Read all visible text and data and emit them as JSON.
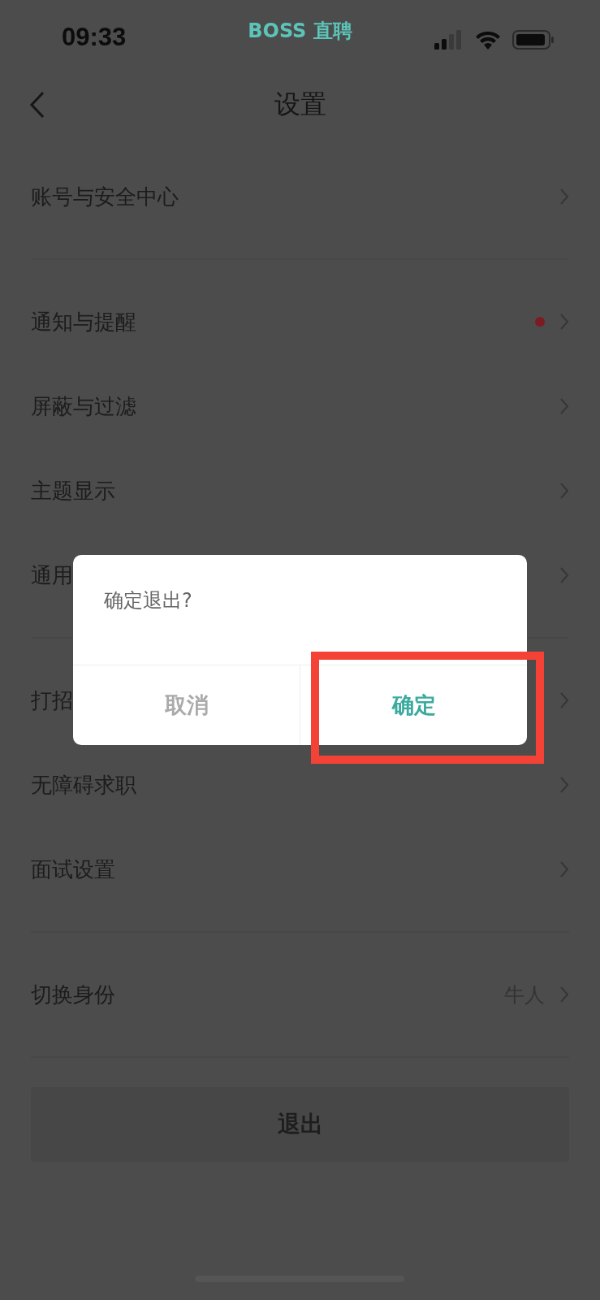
{
  "status_bar": {
    "time": "09:33",
    "app_label": "BOSS 直聘"
  },
  "nav": {
    "title": "设置"
  },
  "groups": [
    [
      {
        "label": "账号与安全中心",
        "unread": false
      }
    ],
    [
      {
        "label": "通知与提醒",
        "unread": true
      },
      {
        "label": "屏蔽与过滤",
        "unread": false
      },
      {
        "label": "主题显示",
        "unread": false
      },
      {
        "label": "通用",
        "unread": false
      }
    ],
    [
      {
        "label": "打招",
        "unread": false
      },
      {
        "label": "无障碍求职",
        "unread": false
      },
      {
        "label": "面试设置",
        "unread": false
      }
    ],
    [
      {
        "label": "切换身份",
        "unread": false,
        "value": "牛人"
      }
    ]
  ],
  "logout_button": "退出",
  "dialog": {
    "message": "确定退出?",
    "buttons": [
      {
        "label": "取消",
        "kind": "cancel",
        "highlighted": false
      },
      {
        "label": "确定",
        "kind": "confirm",
        "highlighted": true
      }
    ]
  }
}
